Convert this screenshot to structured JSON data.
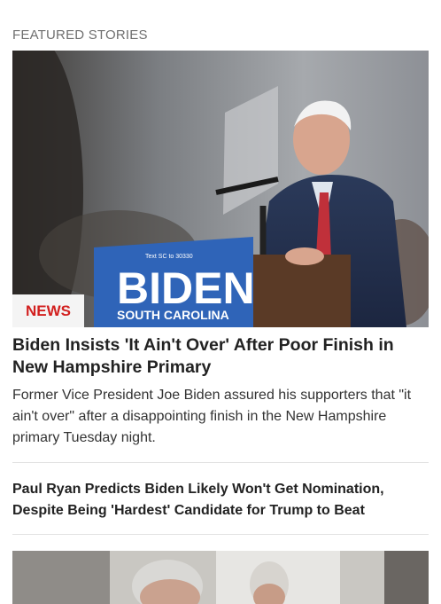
{
  "section": {
    "title": "FEATURED STORIES"
  },
  "featured": {
    "badge": "NEWS",
    "headline": "Biden Insists 'It Ain't Over' After Poor Finish in New Hampshire Primary",
    "summary": "Former Vice President Joe Biden assured his supporters that \"it ain't over\" after a disappointing finish in the New Hampshire primary Tuesday night.",
    "sign": {
      "top_text": "Text SC to 30330",
      "main_text": "BIDEN",
      "sub_text": "SOUTH CAROLINA"
    },
    "colors": {
      "badge_text": "#d2201f",
      "sign_blue": "#2f64b8"
    }
  },
  "stories": [
    {
      "headline": "Paul Ryan Predicts Biden Likely Won't Get Nomination, Despite Being 'Hardest' Candidate for Trump to Beat"
    }
  ]
}
